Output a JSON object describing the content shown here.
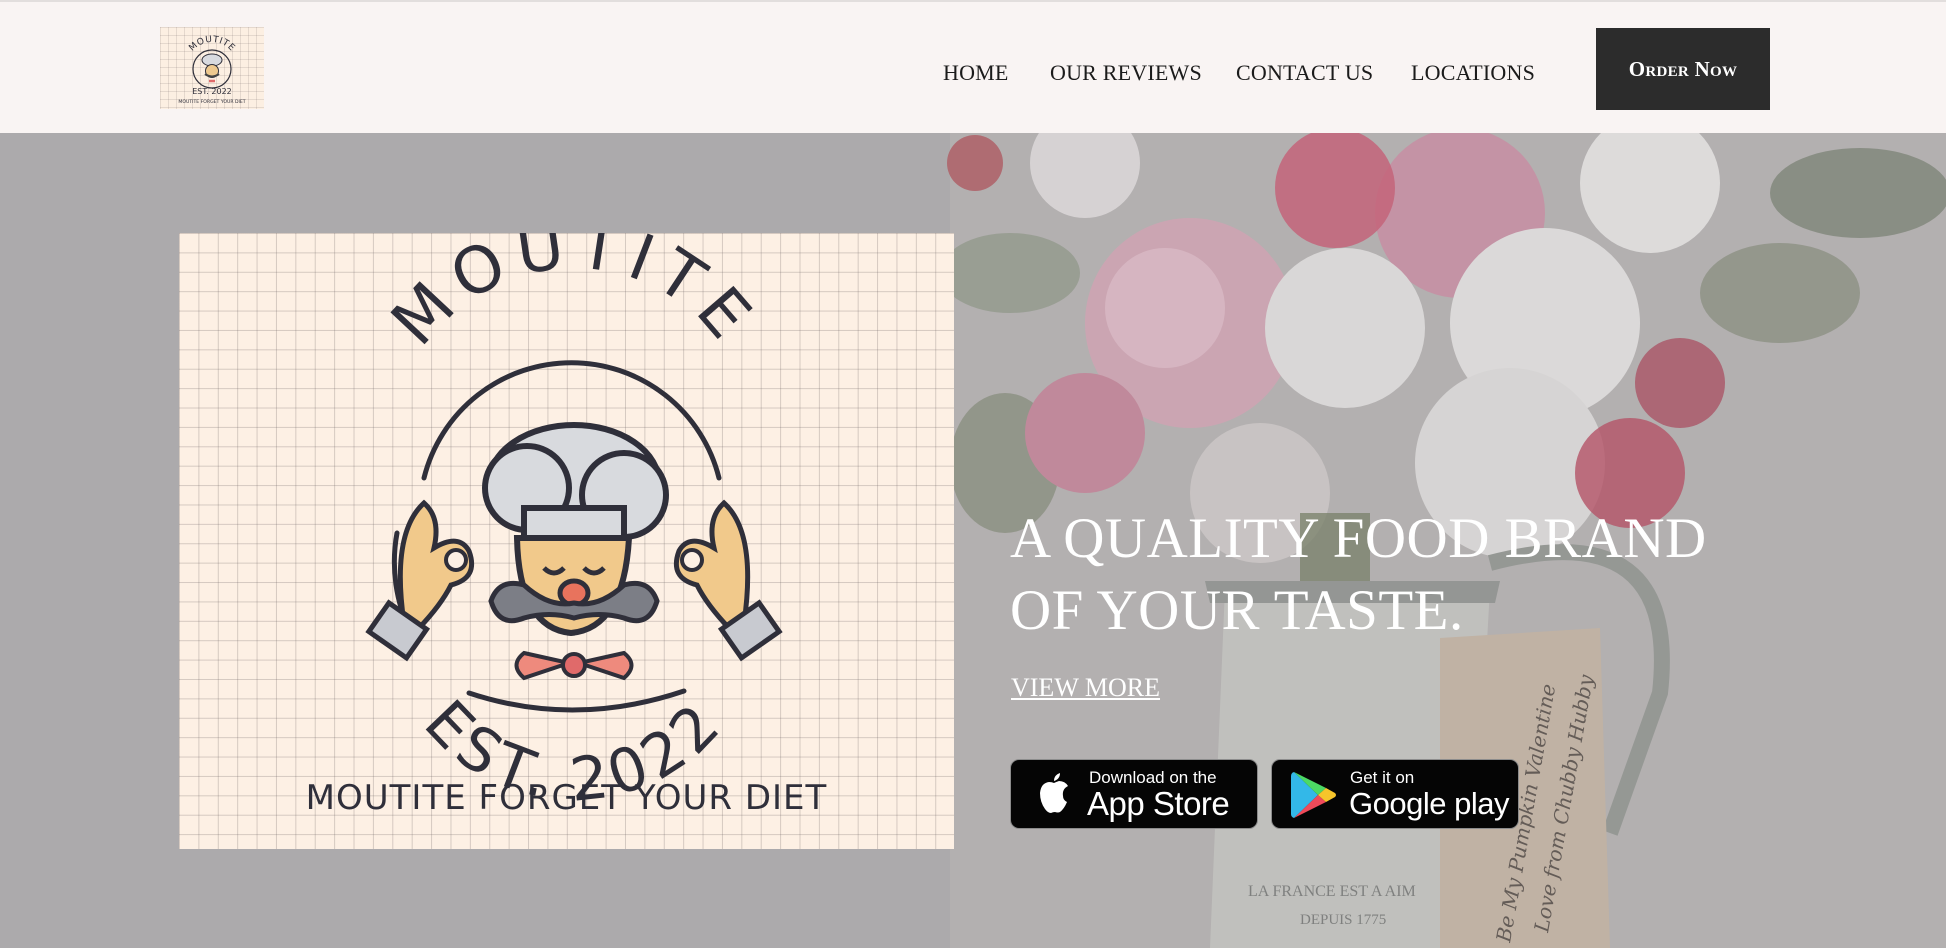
{
  "header": {
    "logo_alt": "Moutite Est. 2022 logo",
    "logo_text": {
      "brand": "MOUTITE",
      "est": "EST. 2022",
      "tagline": "MOUTITE FORGET YOUR DIET"
    },
    "nav": [
      {
        "label": "HOME"
      },
      {
        "label": "OUR REVIEWS"
      },
      {
        "label": "CONTACT US"
      },
      {
        "label": "LOCATIONS"
      }
    ],
    "order_button": "Order Now"
  },
  "hero": {
    "logo": {
      "brand": "MOUTITE",
      "est": "EST. 2022",
      "tagline": "MOUTITE FORGET YOUR DIET"
    },
    "title_line1": "A QUALITY FOOD BRAND",
    "title_line2": "OF YOUR TASTE.",
    "view_more": "VIEW MORE",
    "app_store": {
      "small": "Download on the",
      "big": "App Store",
      "icon": "apple-icon"
    },
    "google_play": {
      "small": "Get it on",
      "big": "Google play",
      "icon": "google-play-icon"
    },
    "background": {
      "jug_text_1": "LA FRANCE EST A AIM",
      "jug_text_2": "DEPUIS 1775",
      "tag_text_1": "Be My Pumpkin Valentine",
      "tag_text_2": "Love from Chubby Hubby"
    }
  },
  "colors": {
    "header_bg": "#f9f4f3",
    "button_bg": "#2c2c2c",
    "hero_overlay": "#aeacad",
    "logo_bg": "#fdf0e4",
    "logo_ink": "#2f2f3a"
  }
}
